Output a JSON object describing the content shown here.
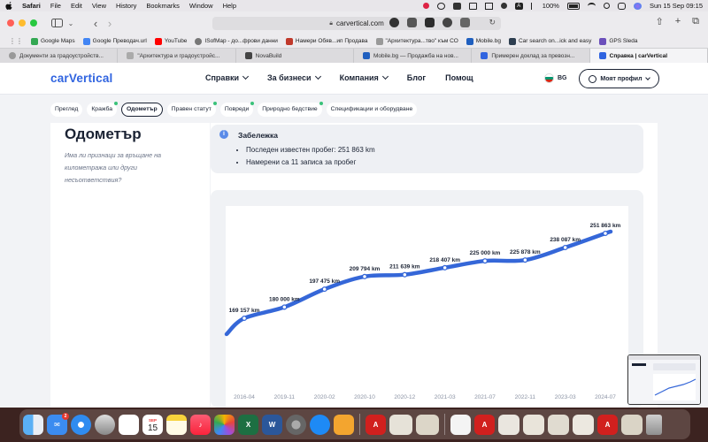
{
  "menubar": {
    "items": [
      "Safari",
      "File",
      "Edit",
      "View",
      "History",
      "Bookmarks",
      "Window",
      "Help"
    ],
    "battery": "100%",
    "input_source": "A",
    "datetime": "Sun 15 Sep  09:15"
  },
  "browser": {
    "url": "carvertical.com",
    "bookmarks": [
      {
        "label": "Google Maps",
        "color": "#34a853"
      },
      {
        "label": "Google Преводач.url",
        "color": "#4285f4"
      },
      {
        "label": "YouTube",
        "color": "#ff0000"
      },
      {
        "label": "ISofMap - до...фрови данни",
        "color": "#777777"
      },
      {
        "label": "Намери Обяв...ип Продава",
        "color": "#c0392b"
      },
      {
        "label": "\"Архитектура...тво\" към СО",
        "color": "#999999"
      },
      {
        "label": "Mobile.bg",
        "color": "#1f5fbf"
      },
      {
        "label": "Car search on...ick and easy",
        "color": "#2d3e50"
      },
      {
        "label": "GPS Sleda",
        "color": "#6b4fbb"
      }
    ],
    "tabs": [
      {
        "label": "Документи за градоустройств...",
        "active": false,
        "color": "#999999"
      },
      {
        "label": "\"Архитектура и градоустройс...",
        "active": false,
        "color": "#999999"
      },
      {
        "label": "NovaBuild",
        "active": false,
        "color": "#444444"
      },
      {
        "label": "Mobile.bg — Продажба на нов...",
        "active": false,
        "color": "#1f5fbf"
      },
      {
        "label": "Примерен доклад за превозн...",
        "active": false,
        "color": "#3064e0"
      },
      {
        "label": "Справка | carVertical",
        "active": true,
        "color": "#3064e0"
      }
    ]
  },
  "site": {
    "logo": "carVertical",
    "nav": [
      {
        "label": "Справки",
        "dropdown": true
      },
      {
        "label": "За бизнеси",
        "dropdown": true
      },
      {
        "label": "Компания",
        "dropdown": true
      },
      {
        "label": "Блог",
        "dropdown": false
      },
      {
        "label": "Помощ",
        "dropdown": false
      }
    ],
    "lang": "BG",
    "profile_label": "Моят профил",
    "subnav": [
      {
        "label": "Преглед",
        "active": false,
        "dot": false
      },
      {
        "label": "Кражба",
        "active": false,
        "dot": true
      },
      {
        "label": "Одометър",
        "active": true,
        "dot": false
      },
      {
        "label": "Правен статут",
        "active": false,
        "dot": true
      },
      {
        "label": "Повреди",
        "active": false,
        "dot": true
      },
      {
        "label": "Природно бедствие",
        "active": false,
        "dot": true
      },
      {
        "label": "Спецификации и оборудване",
        "active": false,
        "dot": false
      }
    ]
  },
  "odometer": {
    "title": "Одометър",
    "subtitle": "Има ли признаци за връщане на километража или други несъответствия?"
  },
  "note": {
    "title": "Забележка",
    "items": [
      "Последен известен пробег: 251 863 km",
      "Намерени са 11 записа за пробег"
    ]
  },
  "chart_data": {
    "type": "line",
    "x": [
      "2016-04",
      "2019-11",
      "2020-02",
      "2020-10",
      "2020-12",
      "2021-03",
      "2021-07",
      "2022-11",
      "2023-03",
      "2024-07"
    ],
    "values": [
      169157,
      180000,
      197475,
      209794,
      211639,
      218407,
      225000,
      225878,
      238087,
      251863
    ],
    "labels": [
      "169 157 km",
      "180 000 km",
      "197 475 km",
      "209 794 km",
      "211 639 km",
      "218 407 km",
      "225 000 km",
      "225 878 km",
      "238 087 km",
      "251 863 km"
    ],
    "title": "",
    "xlabel": "",
    "ylabel": "",
    "grid": false,
    "color": "#3567d8"
  },
  "dock": {
    "mail_badge": "2",
    "calendar_day": "15",
    "calendar_month": "SEP"
  }
}
